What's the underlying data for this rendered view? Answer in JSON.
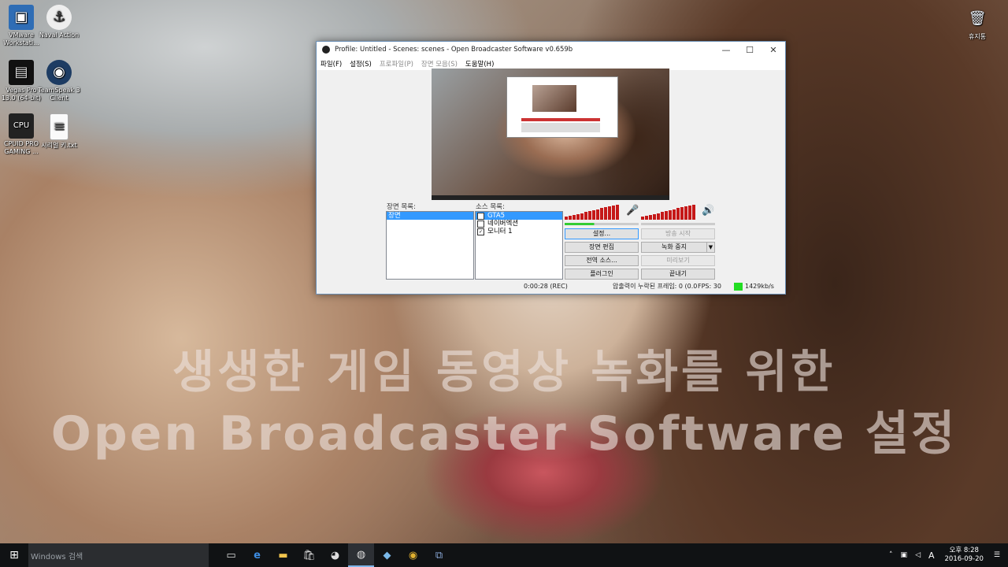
{
  "desktop": {
    "icons": [
      {
        "label": "VMware Workstati...",
        "icon": "vmware-icon"
      },
      {
        "label": "Naval Action",
        "icon": "anchor-icon"
      },
      {
        "label": "Vegas Pro 13.0 (64-bit)",
        "icon": "film-icon"
      },
      {
        "label": "TeamSpeak 3 Client",
        "icon": "teamspeak-icon"
      },
      {
        "label": "CPUID PRO GAMING ...",
        "icon": "cpu-icon"
      },
      {
        "label": "시리얼 키.txt",
        "icon": "text-file-icon"
      },
      {
        "label": "휴지통",
        "icon": "recycle-bin-icon"
      }
    ]
  },
  "obs": {
    "title": "Profile: Untitled - Scenes: scenes - Open Broadcaster Software v0.659b",
    "menu": [
      "파일(F)",
      "설정(S)",
      "프로파일(P)",
      "장면 모음(S)",
      "도움말(H)"
    ],
    "scenes_label": "장면 목록:",
    "sources_label": "소스 목록:",
    "scenes": [
      "장면"
    ],
    "sources": [
      {
        "label": "GTA5",
        "checked": false
      },
      {
        "label": "네이버엑션",
        "checked": false
      },
      {
        "label": "모니터 1",
        "checked": true
      }
    ],
    "buttons": {
      "settings": "설정...",
      "start_stream": "방송 시작",
      "scene_edit": "장면 편집",
      "stop_record": "녹화 중지",
      "global_sources": "전역 소스...",
      "preview": "미리보기",
      "plugins": "플러그인",
      "exit": "끝내기"
    },
    "status": {
      "time": "0:00:28 (REC)",
      "dropped": "압출력이 누락된 프레임: 0 (0.0",
      "fps": "FPS: 30",
      "bitrate": "1429kb/s",
      "bitrate_color": "#22dd22"
    }
  },
  "overlay": {
    "line1": "생생한 게임 동영상 녹화를 위한",
    "line2": "Open Broadcaster Software 설정"
  },
  "taskbar": {
    "search_placeholder": "Windows 검색",
    "apps": [
      "task-view-icon",
      "edge-icon",
      "file-explorer-icon",
      "store-icon",
      "app-icon",
      "obs-icon",
      "app2-icon",
      "chrome-icon",
      "network-app-icon"
    ],
    "clock_top": "오후 8:28",
    "clock_bottom": "2016-09-20",
    "ime": "A"
  }
}
